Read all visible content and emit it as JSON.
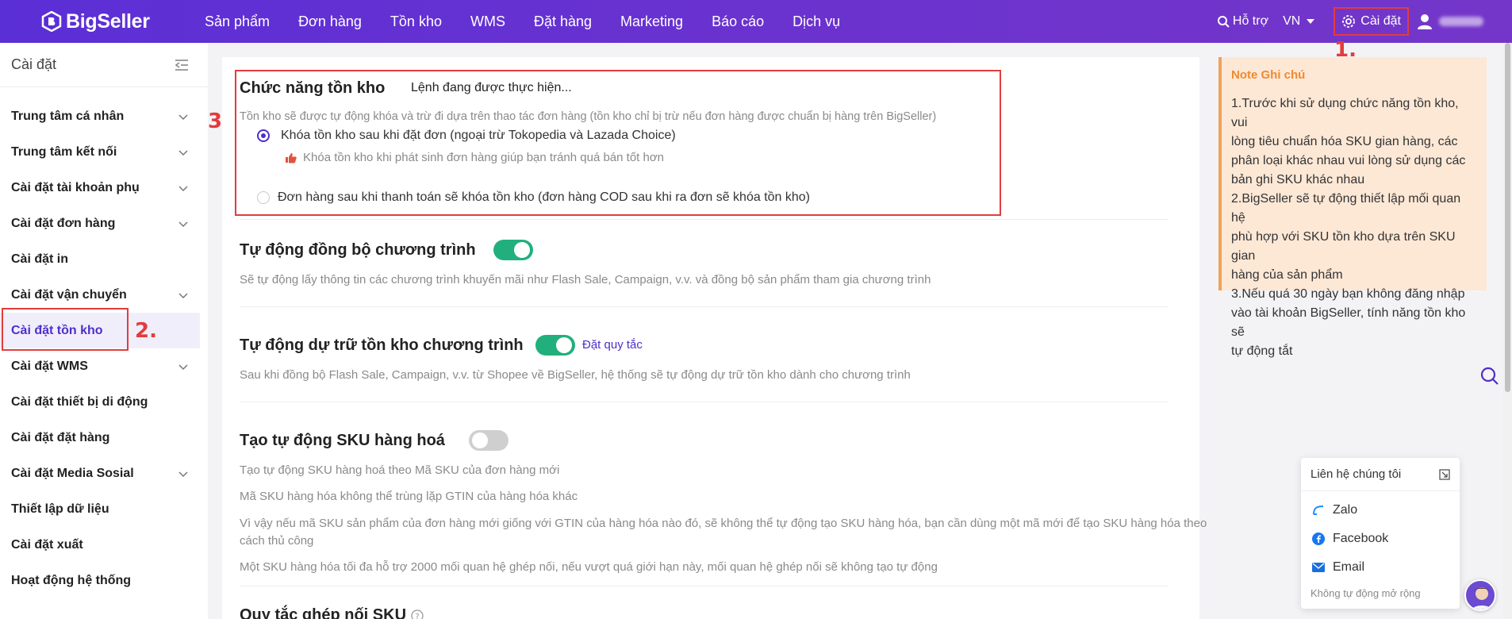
{
  "app": {
    "logo_text": "BigSeller"
  },
  "nav": [
    "Sản phẩm",
    "Đơn hàng",
    "Tồn kho",
    "WMS",
    "Đặt hàng",
    "Marketing",
    "Báo cáo",
    "Dịch vụ"
  ],
  "top_right": {
    "support": "Hỗ trợ",
    "lang": "VN",
    "settings": "Cài đặt"
  },
  "annotations": {
    "a1": "1.",
    "a2": "2.",
    "a3": "3."
  },
  "sidebar": {
    "title": "Cài đặt",
    "items": [
      {
        "label": "Trung tâm cá nhân",
        "chevron": true
      },
      {
        "label": "Trung tâm kết nối",
        "chevron": true
      },
      {
        "label": "Cài đặt tài khoản phụ",
        "chevron": true
      },
      {
        "label": "Cài đặt đơn hàng",
        "chevron": true
      },
      {
        "label": "Cài đặt in",
        "chevron": false
      },
      {
        "label": "Cài đặt vận chuyển",
        "chevron": true
      },
      {
        "label": "Cài đặt tồn kho",
        "chevron": false,
        "active": true
      },
      {
        "label": "Cài đặt WMS",
        "chevron": true
      },
      {
        "label": "Cài đặt thiết bị di động",
        "chevron": false
      },
      {
        "label": "Cài đặt đặt hàng",
        "chevron": false
      },
      {
        "label": "Cài đặt Media Sosial",
        "chevron": true
      },
      {
        "label": "Thiết lập dữ liệu",
        "chevron": false
      },
      {
        "label": "Cài đặt xuất",
        "chevron": false
      },
      {
        "label": "Hoạt động hệ thống",
        "chevron": false
      }
    ]
  },
  "inventory": {
    "title": "Chức năng tồn kho",
    "status": "Lệnh đang được thực hiện...",
    "desc": "Tồn kho sẽ được tự động khóa và trừ đi dựa trên thao tác đơn hàng (tồn kho chỉ bị trừ nếu đơn hàng được chuẩn bị hàng trên BigSeller)",
    "option1": "Khóa tồn kho sau khi đặt đơn (ngoại trừ Tokopedia và Lazada Choice)",
    "option1_hint": "Khóa tồn kho khi phát sinh đơn hàng giúp bạn tránh quá bán tốt hơn",
    "option2": "Đơn hàng sau khi thanh toán sẽ khóa tồn kho (đơn hàng COD sau khi ra đơn sẽ khóa tồn kho)",
    "selected": 1
  },
  "sync": {
    "title": "Tự động đồng bộ chương trình",
    "desc": "Sẽ tự động lấy thông tin các chương trình khuyến mãi như Flash Sale, Campaign, v.v. và đồng bộ sản phẩm tham gia chương trình",
    "enabled": true
  },
  "reserve": {
    "title": "Tự động dự trữ tồn kho chương trình",
    "link": "Đặt quy tắc",
    "desc": "Sau khi đồng bộ Flash Sale, Campaign, v.v. từ Shopee về BigSeller, hệ thống sẽ tự động dự trữ tồn kho dành cho chương trình",
    "enabled": true
  },
  "auto_sku": {
    "title": "Tạo tự động SKU hàng hoá",
    "lines": [
      "Tạo tự động SKU hàng hoá theo Mã SKU của đơn hàng mới",
      "Mã SKU hàng hóa không thể trùng lặp GTIN của hàng hóa khác",
      "Vì vậy nếu mã SKU sản phẩm của đơn hàng mới giống với GTIN của hàng hóa nào đó, sẽ không thể tự động tạo SKU hàng hóa, bạn cần dùng một mã mới để tạo SKU hàng hóa theo",
      "cách thủ công",
      "Một SKU hàng hóa tối đa hỗ trợ 2000 mối quan hệ ghép nối, nếu vượt quá giới hạn này, mối quan hệ ghép nối sẽ không tạo tự động"
    ],
    "enabled": false
  },
  "next_section": {
    "title": "Quy tắc ghép nối SKU"
  },
  "note": {
    "title": "Note Ghi chú",
    "lines": [
      "1.Trước khi sử dụng chức năng tồn kho, vui",
      "lòng tiêu chuẩn hóa SKU gian hàng, các",
      "phân loại khác nhau vui lòng sử dụng các",
      "bản ghi SKU khác nhau",
      "2.BigSeller sẽ tự động thiết lập mối quan hệ",
      "phù hợp với SKU tồn kho dựa trên SKU gian",
      "hàng của sản phẩm",
      "3.Nếu quá 30 ngày bạn không đăng nhập",
      "vào tài khoản BigSeller, tính năng tồn kho sẽ",
      "tự động tắt"
    ]
  },
  "contact": {
    "title": "Liên hệ chúng tôi",
    "items": [
      "Zalo",
      "Facebook",
      "Email"
    ],
    "footer": "Không tự động mở rộng"
  },
  "colors": {
    "brand": "#5b2fd6",
    "accent": "#4f2ec9",
    "toggle_on": "#21b07d",
    "annotation": "#e23c3c",
    "note_bg": "#fde8d6"
  }
}
